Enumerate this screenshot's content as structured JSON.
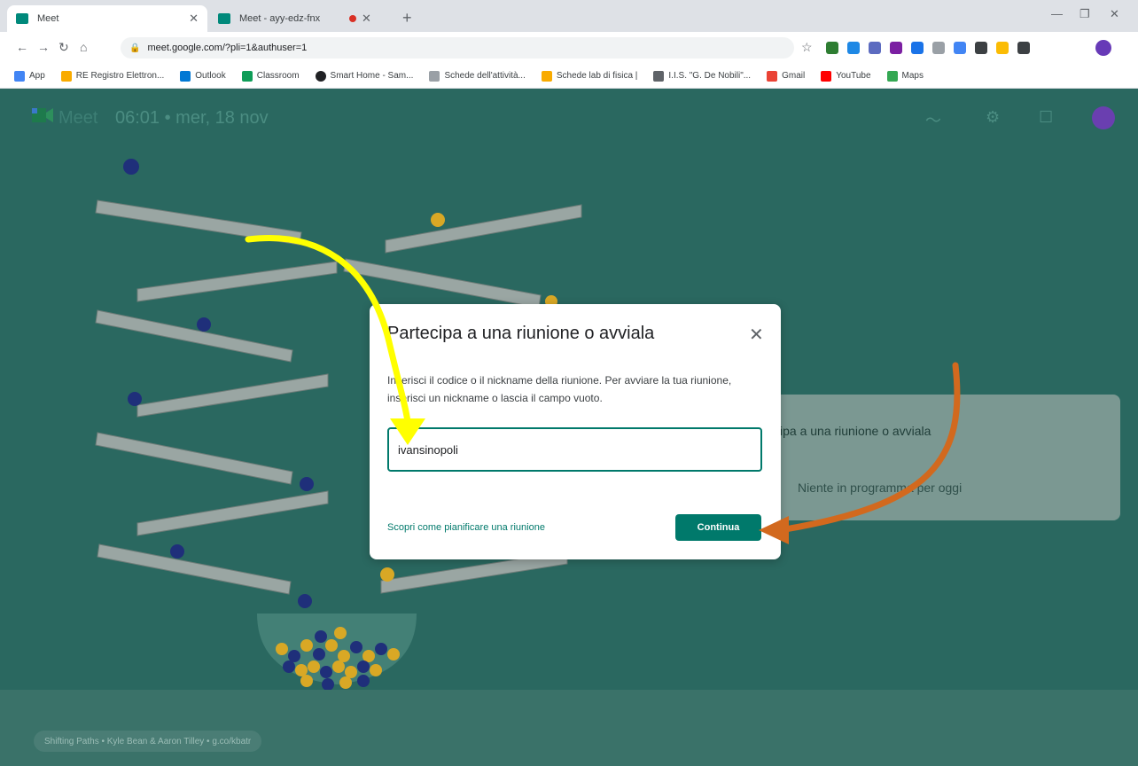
{
  "colors": {
    "teal_bg": "#2a6860",
    "accent": "#00796b",
    "arrow_yellow": "#ffff00",
    "arrow_orange": "#d2691e"
  },
  "browser": {
    "tabs": [
      {
        "title": "Meet",
        "icon": "google-meet-icon"
      },
      {
        "title": "Meet - ayy-edz-fnx",
        "icon": "google-meet-icon"
      }
    ],
    "new_tab_label": "+",
    "address": "meet.google.com/?pli=1&authuser=1",
    "bookmarks": [
      {
        "label": "App",
        "icon": "apps-grid-icon"
      },
      {
        "label": "RE Registro Elettron...",
        "icon": "bookmark-icon"
      },
      {
        "label": "Outlook",
        "icon": "outlook-icon"
      },
      {
        "label": "Classroom",
        "icon": "classroom-icon"
      },
      {
        "label": "Smart Home - Sam...",
        "icon": "smart-home-icon"
      },
      {
        "label": "Schede dell'attività...",
        "icon": "schede-icon"
      },
      {
        "label": "Schede lab di fisica |",
        "icon": "lab-icon"
      },
      {
        "label": "I.I.S. \"G. De Nobili\"...",
        "icon": "school-icon"
      },
      {
        "label": "Gmail",
        "icon": "gmail-icon"
      },
      {
        "label": "YouTube",
        "icon": "youtube-icon"
      },
      {
        "label": "Maps",
        "icon": "maps-icon"
      }
    ]
  },
  "meet": {
    "app_name": "Meet",
    "time_date": "06:01 • mer, 18 nov",
    "bg_card": {
      "join_text": "ipa a una riunione o avviala",
      "schedule_text": "Niente in programma per oggi"
    },
    "credits": "Shifting Paths • Kyle Bean & Aaron Tilley • g.co/kbatr"
  },
  "dialog": {
    "title": "Partecipa a una riunione o avviala",
    "description": "Inserisci il codice o il nickname della riunione. Per avviare la tua riunione, inserisci un nickname o lascia il campo vuoto.",
    "input_value": "ivansinopoli",
    "link": "Scopri come pianificare una riunione",
    "button": "Continua"
  }
}
